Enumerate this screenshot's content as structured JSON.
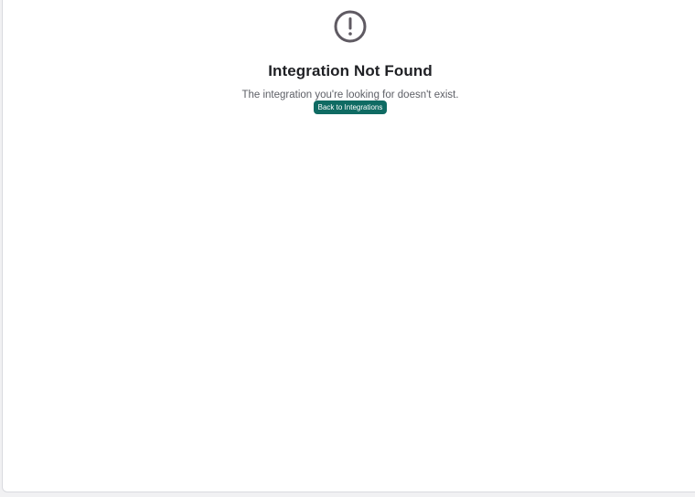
{
  "error_state": {
    "icon": "alert-circle-icon",
    "title": "Integration Not Found",
    "message": "The integration you're looking for doesn't exist.",
    "back_button_label": "Back to Integrations"
  },
  "colors": {
    "accent": "#0f6b63",
    "icon": "#5f5a62",
    "title": "#1f2024",
    "message": "#5d5f66"
  }
}
